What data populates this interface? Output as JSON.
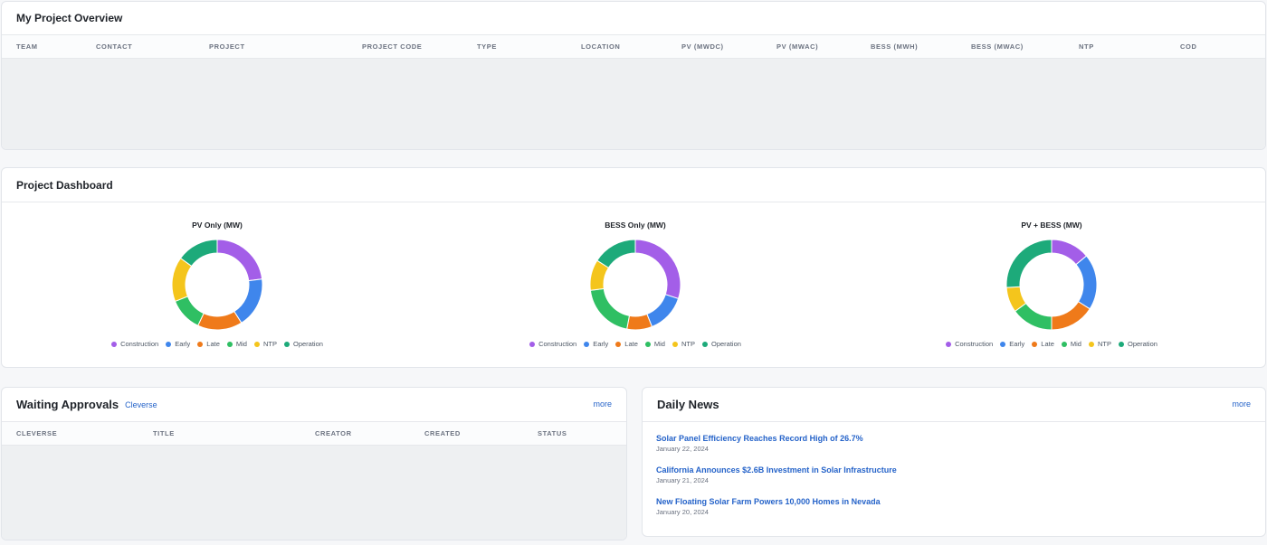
{
  "overview": {
    "title": "My Project Overview",
    "columns": [
      "TEAM",
      "CONTACT",
      "PROJECT",
      "PROJECT CODE",
      "TYPE",
      "LOCATION",
      "PV (MWDC)",
      "PV (MWAC)",
      "BESS (MWH)",
      "BESS (MWAC)",
      "NTP",
      "COD"
    ],
    "rows": []
  },
  "dashboard": {
    "title": "Project Dashboard",
    "legend": [
      {
        "label": "Construction",
        "color": "#a35ee8"
      },
      {
        "label": "Early",
        "color": "#3f86ec"
      },
      {
        "label": "Late",
        "color": "#ef7a1a"
      },
      {
        "label": "Mid",
        "color": "#2fbf63"
      },
      {
        "label": "NTP",
        "color": "#f4c51c"
      },
      {
        "label": "Operation",
        "color": "#1daa7a"
      }
    ]
  },
  "chart_data": [
    {
      "type": "pie",
      "title": "PV Only (MW)",
      "categories": [
        "Construction",
        "Early",
        "Late",
        "Mid",
        "NTP",
        "Operation"
      ],
      "values": [
        23,
        18,
        16,
        12,
        16,
        15
      ]
    },
    {
      "type": "pie",
      "title": "BESS Only (MW)",
      "categories": [
        "Construction",
        "Early",
        "Late",
        "Mid",
        "NTP",
        "Operation"
      ],
      "values": [
        30,
        14,
        9,
        20,
        11,
        16
      ]
    },
    {
      "type": "pie",
      "title": "PV + BESS (MW)",
      "categories": [
        "Construction",
        "Early",
        "Late",
        "Mid",
        "NTP",
        "Operation"
      ],
      "values": [
        14,
        20,
        16,
        15,
        9,
        26
      ]
    }
  ],
  "approvals": {
    "title": "Waiting Approvals",
    "filter_link": "Cleverse",
    "more": "more",
    "columns": [
      "CLEVERSE",
      "TITLE",
      "CREATOR",
      "CREATED",
      "STATUS"
    ],
    "rows": []
  },
  "news": {
    "title": "Daily News",
    "more": "more",
    "items": [
      {
        "title": "Solar Panel Efficiency Reaches Record High of 26.7%",
        "date": "January 22, 2024"
      },
      {
        "title": "California Announces $2.6B Investment in Solar Infrastructure",
        "date": "January 21, 2024"
      },
      {
        "title": "New Floating Solar Farm Powers 10,000 Homes in Nevada",
        "date": "January 20, 2024"
      }
    ]
  }
}
